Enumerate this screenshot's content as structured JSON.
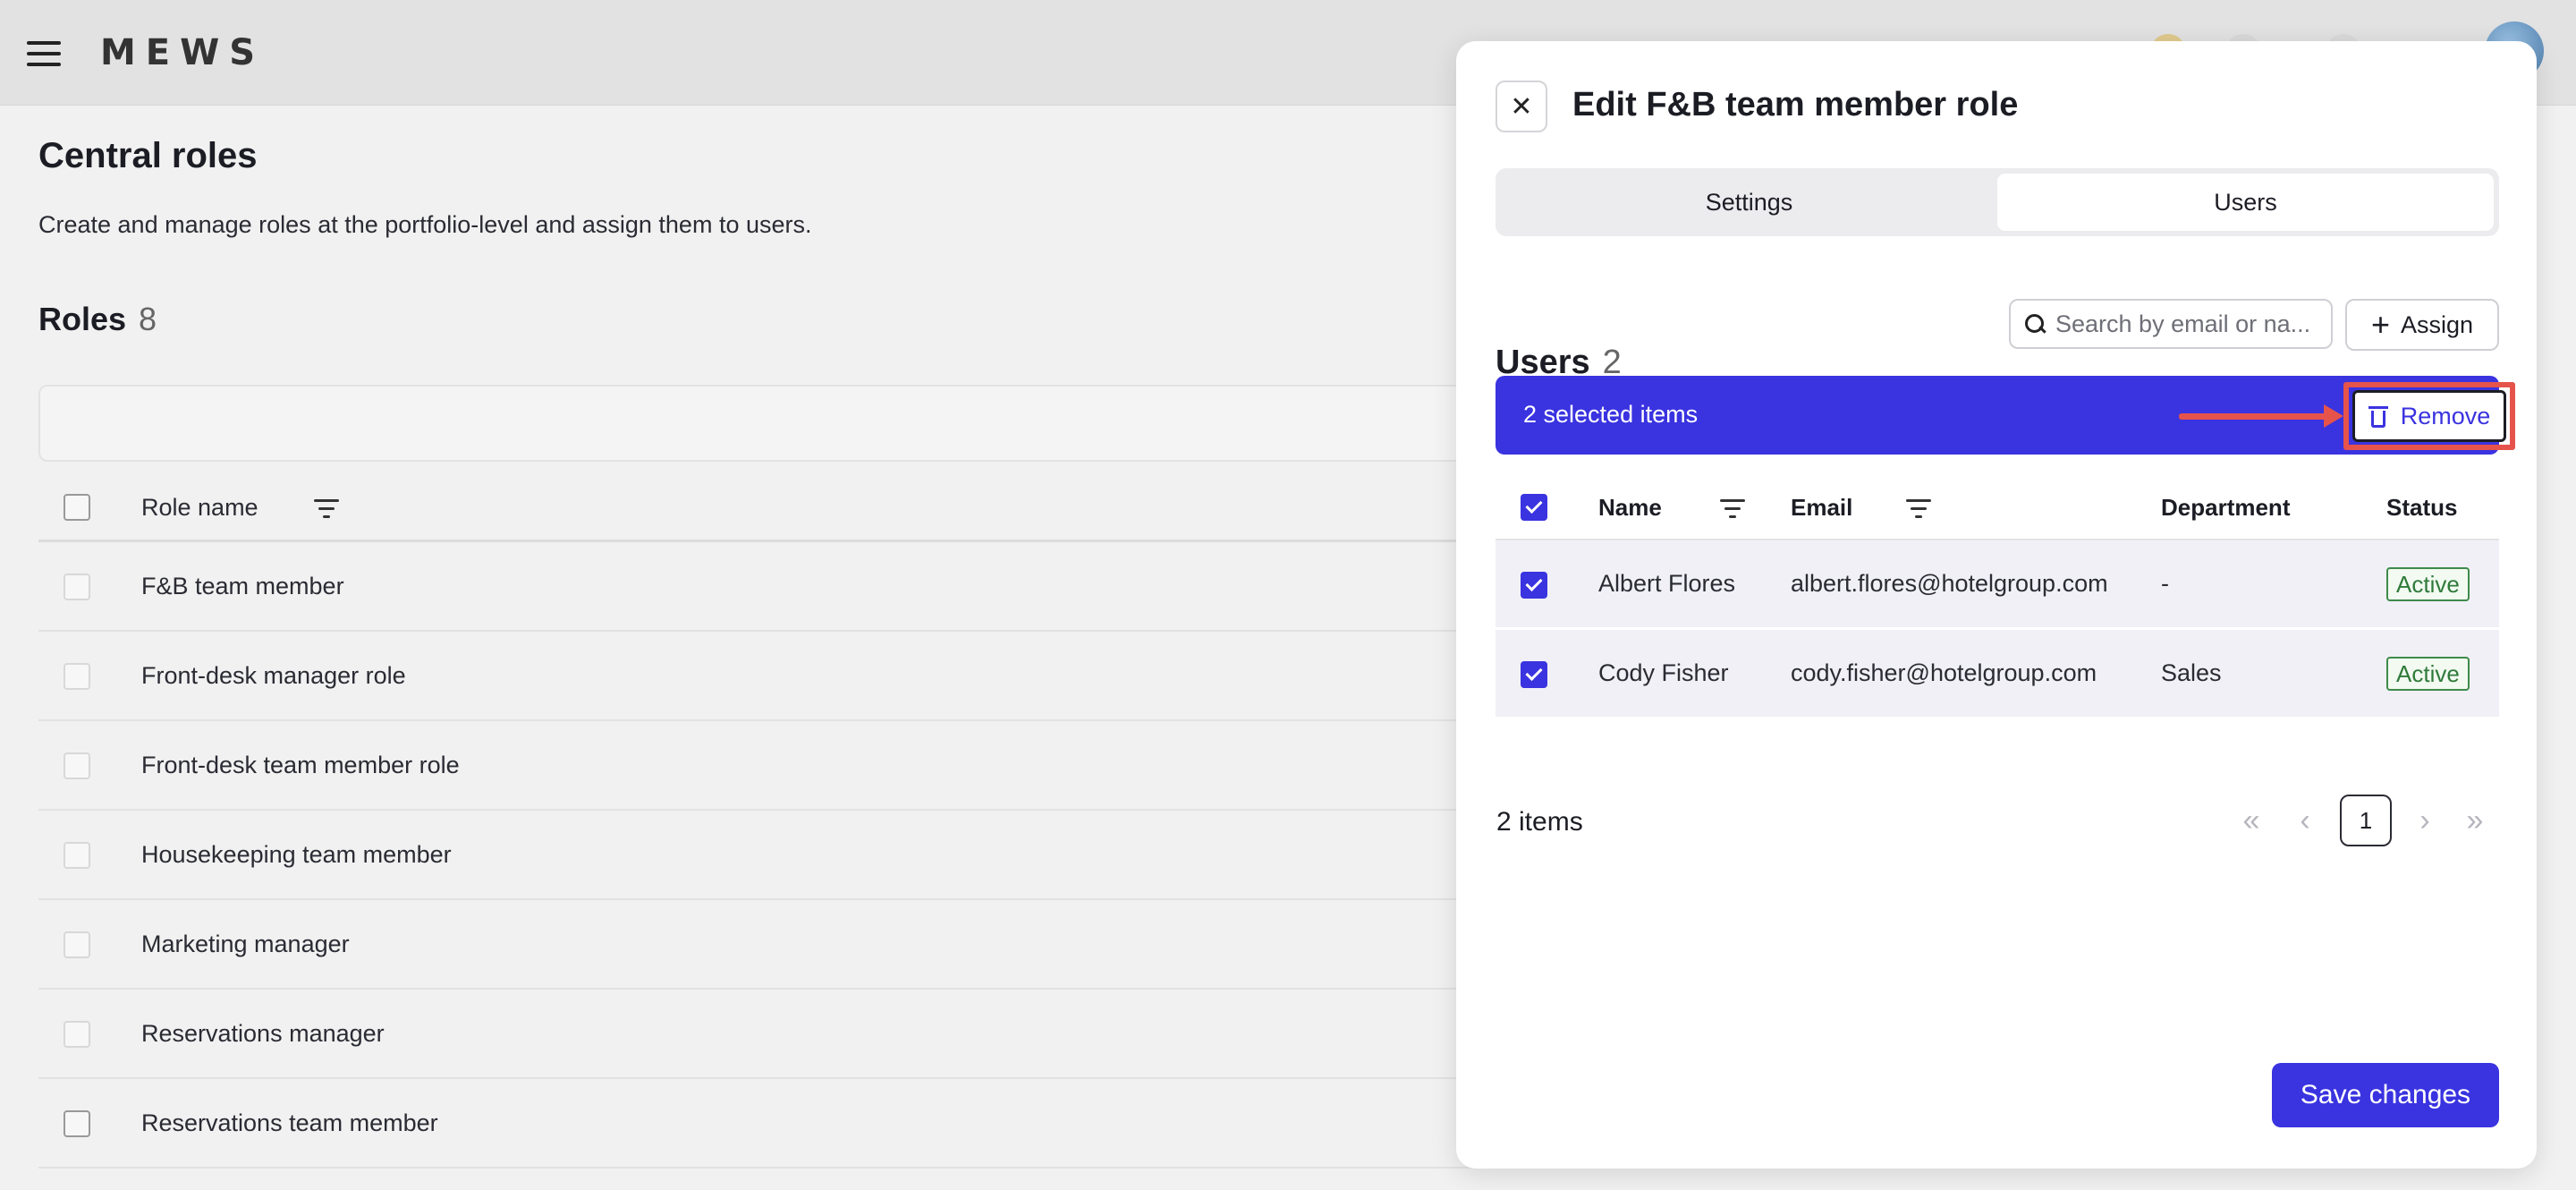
{
  "topbar": {
    "logo": "MEWS"
  },
  "page": {
    "title": "Central roles",
    "description": "Create and manage roles at the portfolio-level and assign them to users.",
    "roles_label": "Roles",
    "roles_count": "8",
    "column_role_name": "Role name",
    "roles": [
      "F&B team member",
      "Front-desk manager role",
      "Front-desk team member role",
      "Housekeeping team member",
      "Marketing manager",
      "Reservations manager",
      "Reservations team member"
    ]
  },
  "panel": {
    "title": "Edit F&B team member role",
    "tabs": [
      "Settings",
      "Users"
    ],
    "active_tab": "Users",
    "users_label": "Users",
    "users_count": "2",
    "search_placeholder": "Search by email or na...",
    "assign_label": "Assign",
    "selection_text": "2 selected items",
    "remove_label": "Remove",
    "columns": {
      "name": "Name",
      "email": "Email",
      "department": "Department",
      "status": "Status"
    },
    "users": [
      {
        "name": "Albert Flores",
        "email": "albert.flores@hotelgroup.com",
        "department": "-",
        "status": "Active",
        "selected": true
      },
      {
        "name": "Cody Fisher",
        "email": "cody.fisher@hotelgroup.com",
        "department": "Sales",
        "status": "Active",
        "selected": true
      }
    ],
    "items_count": "2 items",
    "current_page": "1",
    "save_label": "Save changes"
  },
  "colors": {
    "accent": "#3a33e0",
    "annotation": "#e5534b",
    "status_active": "#2f7a3a"
  }
}
